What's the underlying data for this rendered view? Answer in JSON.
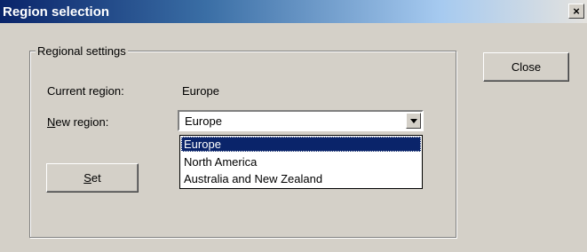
{
  "window": {
    "title": "Region selection",
    "close_glyph": "×"
  },
  "group": {
    "label": "Regional settings",
    "current_region_label": "Current region:",
    "current_region_value": "Europe",
    "new_region_prefix": "N",
    "new_region_rest": "ew region:",
    "selected_region": "Europe"
  },
  "buttons": {
    "close_label": "Close",
    "set_mnemonic": "S",
    "set_rest": "et"
  },
  "dropdown": {
    "options": [
      "Europe",
      "North America",
      "Australia and New Zealand"
    ],
    "highlighted": "Europe"
  },
  "icons": {
    "close": "close-icon",
    "dropdown_arrow": "chevron-down-icon"
  },
  "colors": {
    "title_start": "#0a246a",
    "selection": "#0a246a",
    "dialog_bg": "#d4d0c8"
  }
}
